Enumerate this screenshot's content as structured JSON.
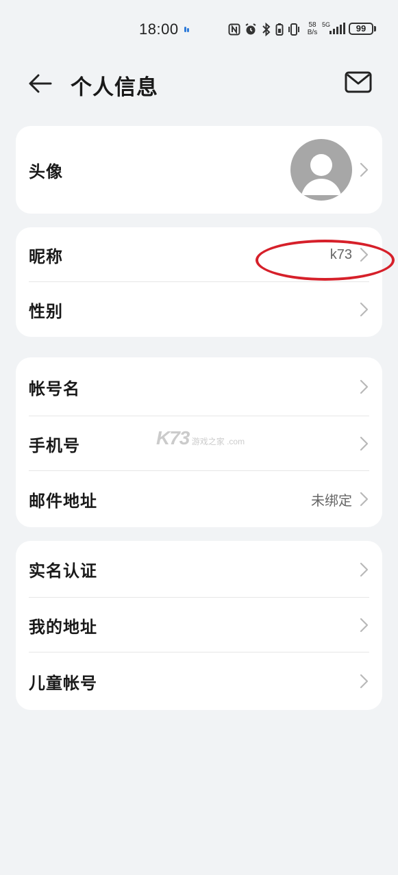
{
  "status_bar": {
    "time": "18:00",
    "speed_value": "58",
    "speed_unit": "B/s",
    "network": "5G",
    "battery": "99"
  },
  "header": {
    "title": "个人信息"
  },
  "sections": {
    "avatar": {
      "label": "头像"
    },
    "profile": {
      "nickname_label": "昵称",
      "nickname_value": "k73",
      "gender_label": "性别"
    },
    "account": {
      "account_name_label": "帐号名",
      "phone_label": "手机号",
      "email_label": "邮件地址",
      "email_value": "未绑定"
    },
    "more": {
      "realname_label": "实名认证",
      "address_label": "我的地址",
      "child_label": "儿童帐号"
    }
  },
  "watermark": {
    "logo": "K73",
    "site": "游戏之家",
    "domain": ".com"
  },
  "colors": {
    "background": "#f1f3f5",
    "card": "#ffffff",
    "annotation": "#d6202a",
    "avatar": "#a7a7a7"
  }
}
